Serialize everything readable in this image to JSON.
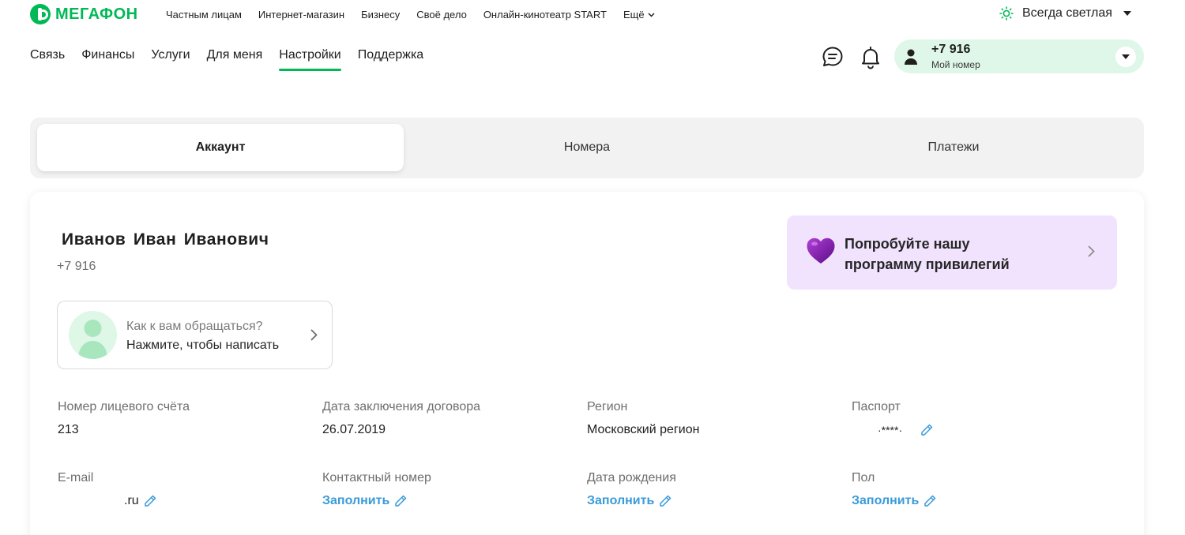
{
  "brand": {
    "name": "МЕГАФОН",
    "color": "#00b956"
  },
  "top_links": [
    "Частным лицам",
    "Интернет-магазин",
    "Бизнесу",
    "Своё дело",
    "Онлайн-кинотеатр START"
  ],
  "more_label": "Ещё",
  "theme_label": "Всегда светлая",
  "main_nav": [
    "Связь",
    "Финансы",
    "Услуги",
    "Для меня",
    "Настройки",
    "Поддержка"
  ],
  "active_nav": "Настройки",
  "account": {
    "number": "+7 916",
    "label": "Мой номер"
  },
  "tabs": [
    "Аккаунт",
    "Номера",
    "Платежи"
  ],
  "active_tab": "Аккаунт",
  "profile": {
    "full_name": "Иванов Иван Иванович",
    "phone": "+7 916"
  },
  "promo": {
    "text": "Попробуйте нашу программу привилегий",
    "bg_color": "#f1e3fd"
  },
  "address": {
    "question": "Как к вам обращаться?",
    "hint": "Нажмите, чтобы написать"
  },
  "fields": {
    "account_number": {
      "label": "Номер лицевого счёта",
      "value": "213"
    },
    "contract_date": {
      "label": "Дата заключения договора",
      "value": "26.07.2019"
    },
    "region": {
      "label": "Регион",
      "value": "Московский регион"
    },
    "passport": {
      "label": "Паспорт",
      "value": "·****·"
    },
    "email": {
      "label": "E-mail",
      "value": ".ru"
    },
    "contact_number": {
      "label": "Контактный номер",
      "value": "Заполнить"
    },
    "birth_date": {
      "label": "Дата рождения",
      "value": "Заполнить"
    },
    "gender": {
      "label": "Пол",
      "value": "Заполнить"
    }
  },
  "link_color": "#3a9bd9"
}
